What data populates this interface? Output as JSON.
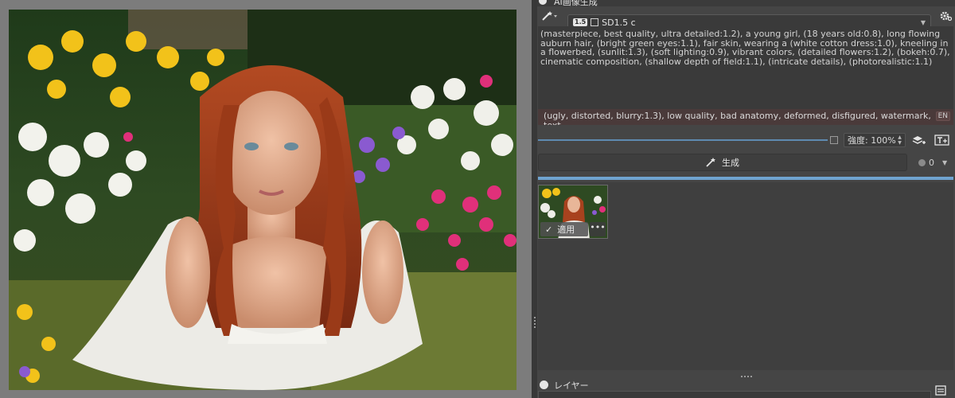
{
  "docker": {
    "title": "AI画像生成",
    "model": {
      "badge": "1.5",
      "name": "SD1.5 c"
    },
    "prompt": "(masterpiece, best quality, ultra detailed:1.2), a young girl, (18 years old:0.8), long flowing auburn hair, (bright green eyes:1.1), fair skin, wearing a (white cotton dress:1.0), kneeling in a flowerbed, (sunlit:1.3), (soft lighting:0.9), vibrant colors, (detailed flowers:1.2), (bokeh:0.7), cinematic composition, (shallow depth of field:1.1),  (intricate details), (photorealistic:1.1)",
    "negative_prompt": "(ugly, distorted, blurry:1.3), low quality, bad anatomy, deformed, disfigured, watermark, text,",
    "negative_lang": "EN",
    "strength_label": "強度: 100%",
    "strength_value": 1.0,
    "generate_label": "生成",
    "queue_count": "0",
    "history": [
      {
        "apply_label": "適用",
        "more_label": "•••"
      }
    ]
  },
  "layers": {
    "title": "レイヤー"
  },
  "colors": {
    "accent": "#6fa3cf",
    "panel": "#454545",
    "canvas_bg": "#7c7c7c"
  }
}
